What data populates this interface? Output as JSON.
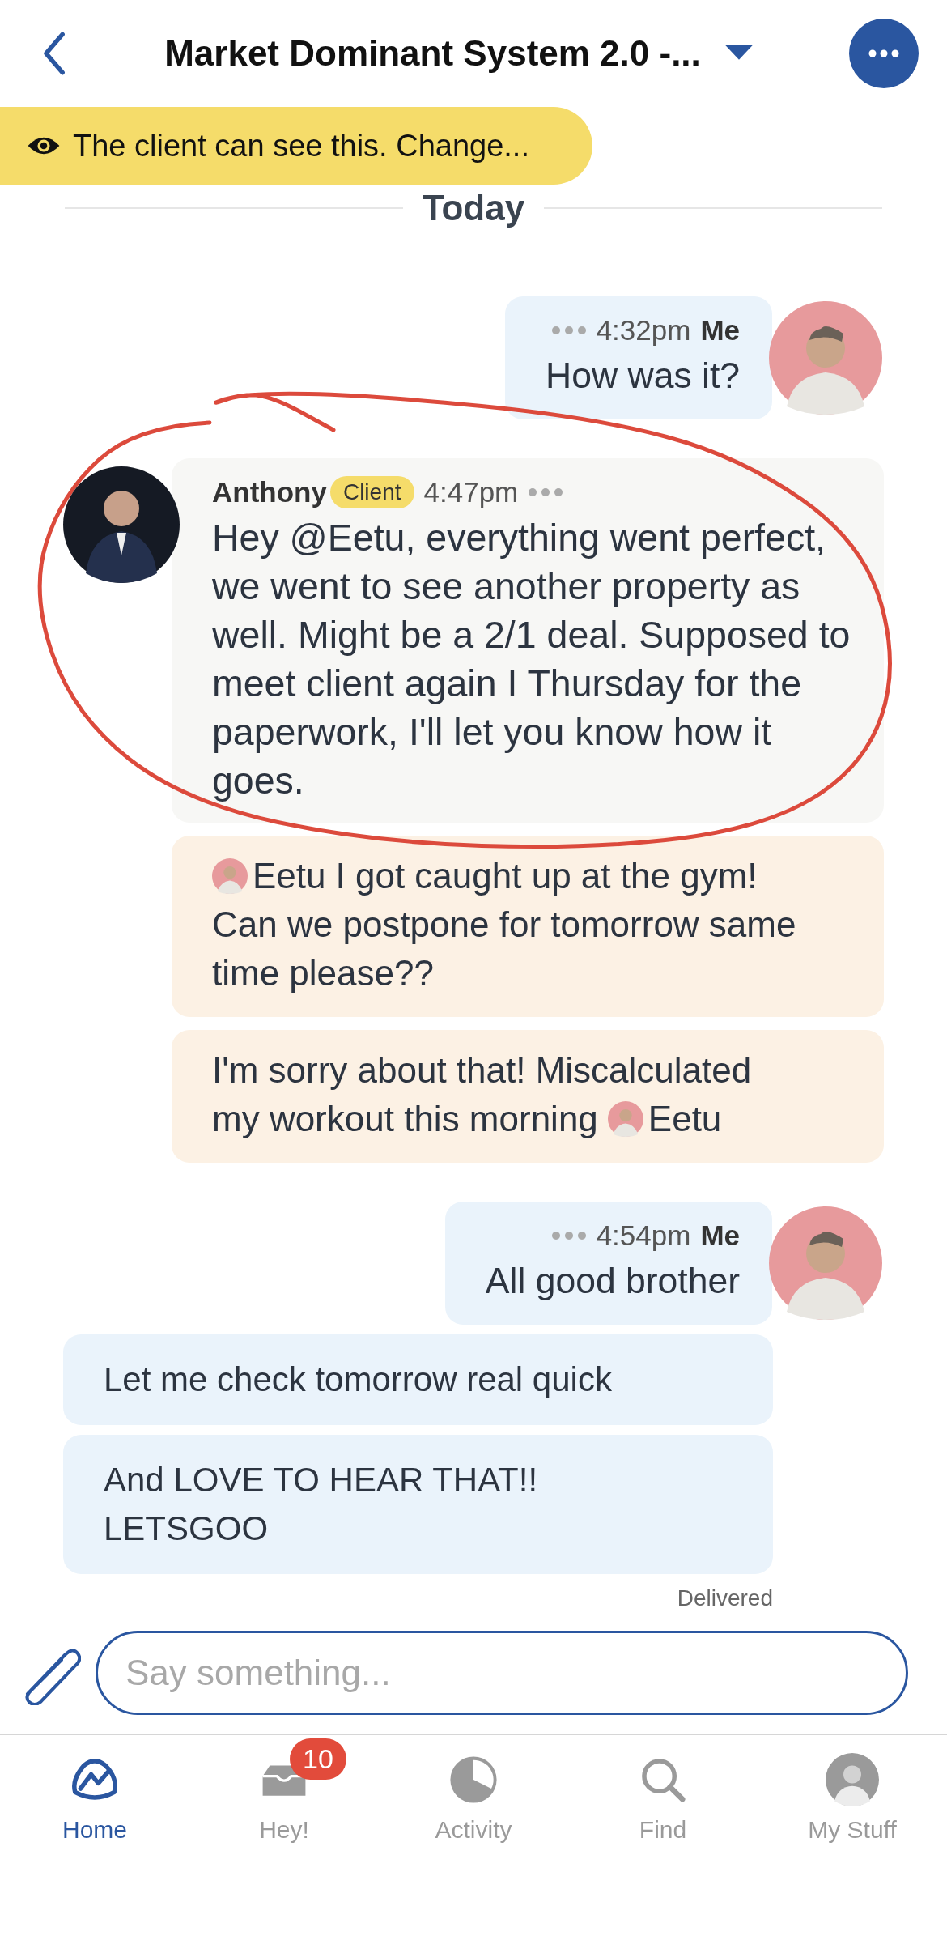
{
  "header": {
    "title": "Market Dominant System 2.0 -..."
  },
  "visibility_banner": {
    "text": "The client can see this. Change..."
  },
  "day_divider": "Today",
  "messages": [
    {
      "kind": "mine",
      "time": "4:32pm",
      "author": "Me",
      "parts": [
        {
          "kind": "text",
          "text": "How was it?"
        }
      ]
    },
    {
      "kind": "theirs",
      "author": "Anthony",
      "badge": "Client",
      "time": "4:47pm",
      "parts": [
        {
          "kind": "text",
          "text": "Hey @Eetu, everything went perfect, we went to see another property as well. Might be a 2/1 deal. Supposed to meet client again I Thursday for the paperwork, I'll let you know how it goes."
        }
      ]
    },
    {
      "kind": "their_followup",
      "lines": [
        [
          {
            "kind": "mention",
            "text": "Eetu"
          },
          {
            "kind": "text",
            "text": "I got caught up at the gym!"
          }
        ],
        [
          {
            "kind": "text",
            "text": "Can we postpone for tomorrow same time please??"
          }
        ]
      ]
    },
    {
      "kind": "their_followup",
      "lines": [
        [
          {
            "kind": "text",
            "text": "I'm sorry about that! Miscalculated"
          }
        ],
        [
          {
            "kind": "text",
            "text": "my workout this morning"
          },
          {
            "kind": "mention",
            "text": "Eetu"
          }
        ]
      ]
    },
    {
      "kind": "mine",
      "time": "4:54pm",
      "author": "Me",
      "parts": [
        {
          "kind": "text",
          "text": "All good brother"
        }
      ]
    },
    {
      "kind": "my_followup",
      "lines": [
        [
          {
            "kind": "text",
            "text": "Let me check tomorrow real quick"
          }
        ]
      ]
    },
    {
      "kind": "my_followup",
      "lines": [
        [
          {
            "kind": "text",
            "text": "And LOVE TO HEAR THAT!!\nLETSGOO"
          }
        ]
      ]
    }
  ],
  "delivery_status": "Delivered",
  "composer": {
    "placeholder": "Say something..."
  },
  "tabs": [
    {
      "label": "Home",
      "selected": true
    },
    {
      "label": "Hey!",
      "selected": false,
      "badge": "10"
    },
    {
      "label": "Activity",
      "selected": false
    },
    {
      "label": "Find",
      "selected": false
    },
    {
      "label": "My Stuff",
      "selected": false
    }
  ]
}
